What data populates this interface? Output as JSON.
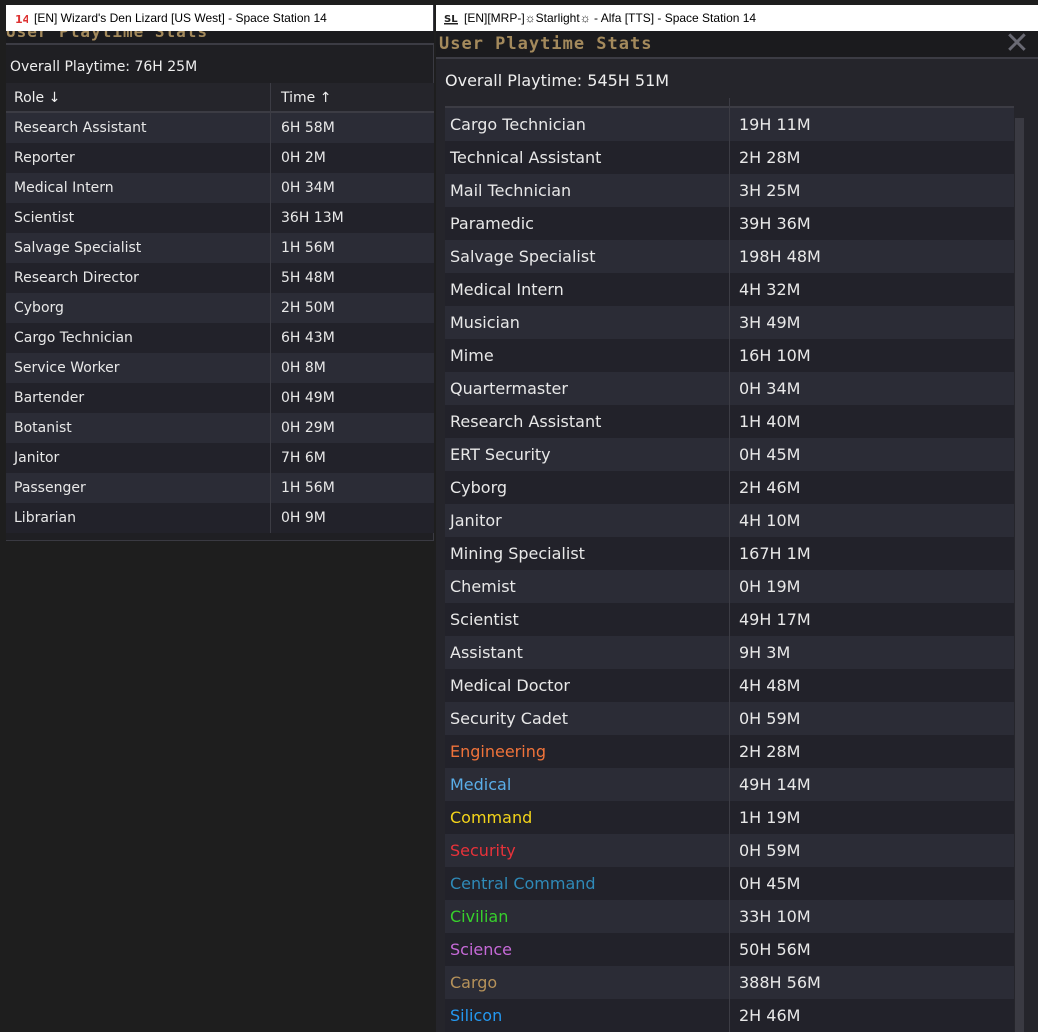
{
  "left_window": {
    "title": "[EN] Wizard's Den Lizard [US West] - Space Station 14",
    "icon": "ss14-icon",
    "header": "User Playtime Stats",
    "overall": "Overall Playtime: 76H 25M",
    "columns": [
      "Role ↓",
      "Time ↑"
    ],
    "rows": [
      {
        "role": "Research Assistant",
        "time": "6H 58M"
      },
      {
        "role": "Reporter",
        "time": "0H 2M"
      },
      {
        "role": "Medical Intern",
        "time": "0H 34M"
      },
      {
        "role": "Scientist",
        "time": "36H 13M"
      },
      {
        "role": "Salvage Specialist",
        "time": "1H 56M"
      },
      {
        "role": "Research Director",
        "time": "5H 48M"
      },
      {
        "role": "Cyborg",
        "time": "2H 50M"
      },
      {
        "role": "Cargo Technician",
        "time": "6H 43M"
      },
      {
        "role": "Service Worker",
        "time": "0H 8M"
      },
      {
        "role": "Bartender",
        "time": "0H 49M"
      },
      {
        "role": "Botanist",
        "time": "0H 29M"
      },
      {
        "role": "Janitor",
        "time": "7H 6M"
      },
      {
        "role": "Passenger",
        "time": "1H 56M"
      },
      {
        "role": "Librarian",
        "time": "0H 9M"
      }
    ]
  },
  "right_window": {
    "title": "[EN][MRP-]☼Starlight☼ - Alfa [TTS] - Space Station 14",
    "icon": "sl-icon",
    "header": "User Playtime Stats",
    "close": "✕",
    "overall": "Overall Playtime: 545H 51M",
    "rows": [
      {
        "role": "Cargo Technician",
        "time": "19H 11M",
        "color": "#e8e8e8"
      },
      {
        "role": "Technical Assistant",
        "time": "2H 28M",
        "color": "#e8e8e8"
      },
      {
        "role": "Mail Technician",
        "time": "3H 25M",
        "color": "#e8e8e8"
      },
      {
        "role": "Paramedic",
        "time": "39H 36M",
        "color": "#e8e8e8"
      },
      {
        "role": "Salvage Specialist",
        "time": "198H 48M",
        "color": "#e8e8e8"
      },
      {
        "role": "Medical Intern",
        "time": "4H 32M",
        "color": "#e8e8e8"
      },
      {
        "role": "Musician",
        "time": "3H 49M",
        "color": "#e8e8e8"
      },
      {
        "role": "Mime",
        "time": "16H 10M",
        "color": "#e8e8e8"
      },
      {
        "role": "Quartermaster",
        "time": "0H 34M",
        "color": "#e8e8e8"
      },
      {
        "role": "Research Assistant",
        "time": "1H 40M",
        "color": "#e8e8e8"
      },
      {
        "role": "ERT Security",
        "time": "0H 45M",
        "color": "#e8e8e8"
      },
      {
        "role": "Cyborg",
        "time": "2H 46M",
        "color": "#e8e8e8"
      },
      {
        "role": "Janitor",
        "time": "4H 10M",
        "color": "#e8e8e8"
      },
      {
        "role": "Mining Specialist",
        "time": "167H 1M",
        "color": "#e8e8e8"
      },
      {
        "role": "Chemist",
        "time": "0H 19M",
        "color": "#e8e8e8"
      },
      {
        "role": "Scientist",
        "time": "49H 17M",
        "color": "#e8e8e8"
      },
      {
        "role": "Assistant",
        "time": "9H 3M",
        "color": "#e8e8e8"
      },
      {
        "role": "Medical Doctor",
        "time": "4H 48M",
        "color": "#e8e8e8"
      },
      {
        "role": "Security Cadet",
        "time": "0H 59M",
        "color": "#e8e8e8"
      },
      {
        "role": "Engineering",
        "time": "2H 28M",
        "color": "#f0733a"
      },
      {
        "role": "Medical",
        "time": "49H 14M",
        "color": "#5aaee8"
      },
      {
        "role": "Command",
        "time": "1H 19M",
        "color": "#f3d41a"
      },
      {
        "role": "Security",
        "time": "0H 59M",
        "color": "#e8323a"
      },
      {
        "role": "Central Command",
        "time": "0H 45M",
        "color": "#2f8ab8"
      },
      {
        "role": "Civilian",
        "time": "33H 10M",
        "color": "#37d02c"
      },
      {
        "role": "Science",
        "time": "50H 56M",
        "color": "#c66ad8"
      },
      {
        "role": "Cargo",
        "time": "388H 56M",
        "color": "#b6925a"
      },
      {
        "role": "Silicon",
        "time": "2H 46M",
        "color": "#2498f0"
      }
    ]
  }
}
